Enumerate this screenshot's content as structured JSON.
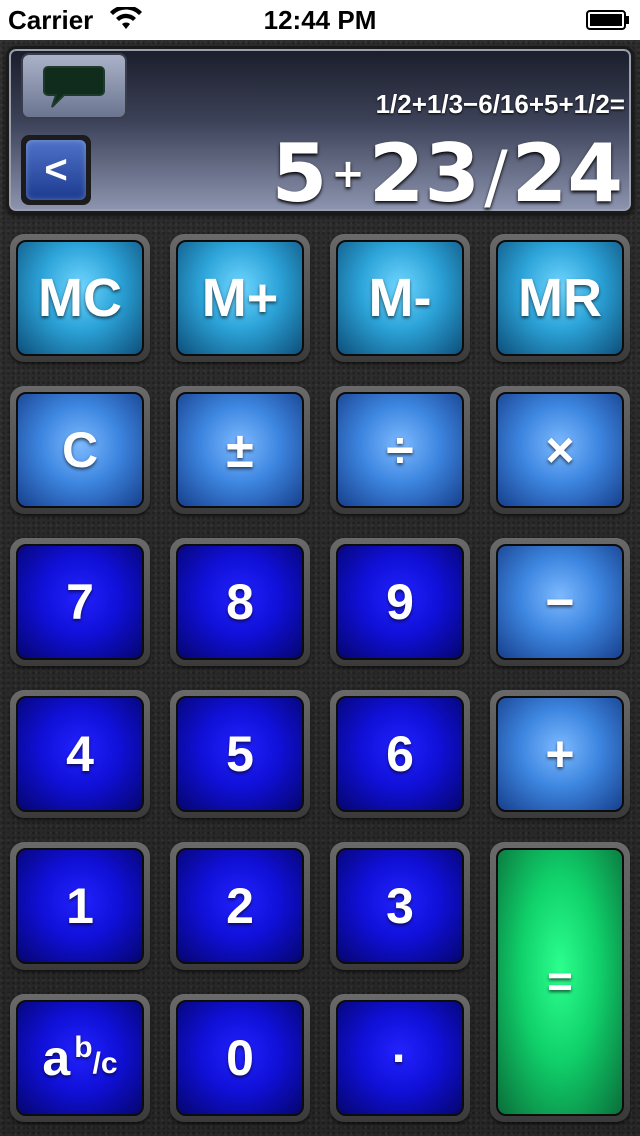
{
  "status_bar": {
    "carrier": "Carrier",
    "time": "12:44 PM"
  },
  "display": {
    "expression": "1/2+1/3−6/16+5+1/2=",
    "result_whole": "5",
    "result_plus": "+",
    "result_numerator": "23",
    "result_slash": "/",
    "result_denominator": "24",
    "back_label": "<"
  },
  "keys": {
    "mc": "MC",
    "m_plus": "M+",
    "m_minus": "M-",
    "mr": "MR",
    "clear": "C",
    "plus_minus": "±",
    "divide": "÷",
    "multiply": "×",
    "seven": "7",
    "eight": "8",
    "nine": "9",
    "minus": "−",
    "four": "4",
    "five": "5",
    "six": "6",
    "plus": "+",
    "one": "1",
    "two": "2",
    "three": "3",
    "equals": "=",
    "frac_a": "a",
    "frac_b": "b",
    "frac_slash_c": "/c",
    "zero": "0",
    "decimal": "·"
  },
  "colors": {
    "memory_key": "#2ca3d8",
    "operator_key": "#3d86e0",
    "number_key": "#1010d8",
    "equals_key": "#10d06a"
  },
  "icons": {
    "chat": "speech-bubble-icon",
    "wifi": "wifi-icon",
    "battery": "battery-icon"
  }
}
